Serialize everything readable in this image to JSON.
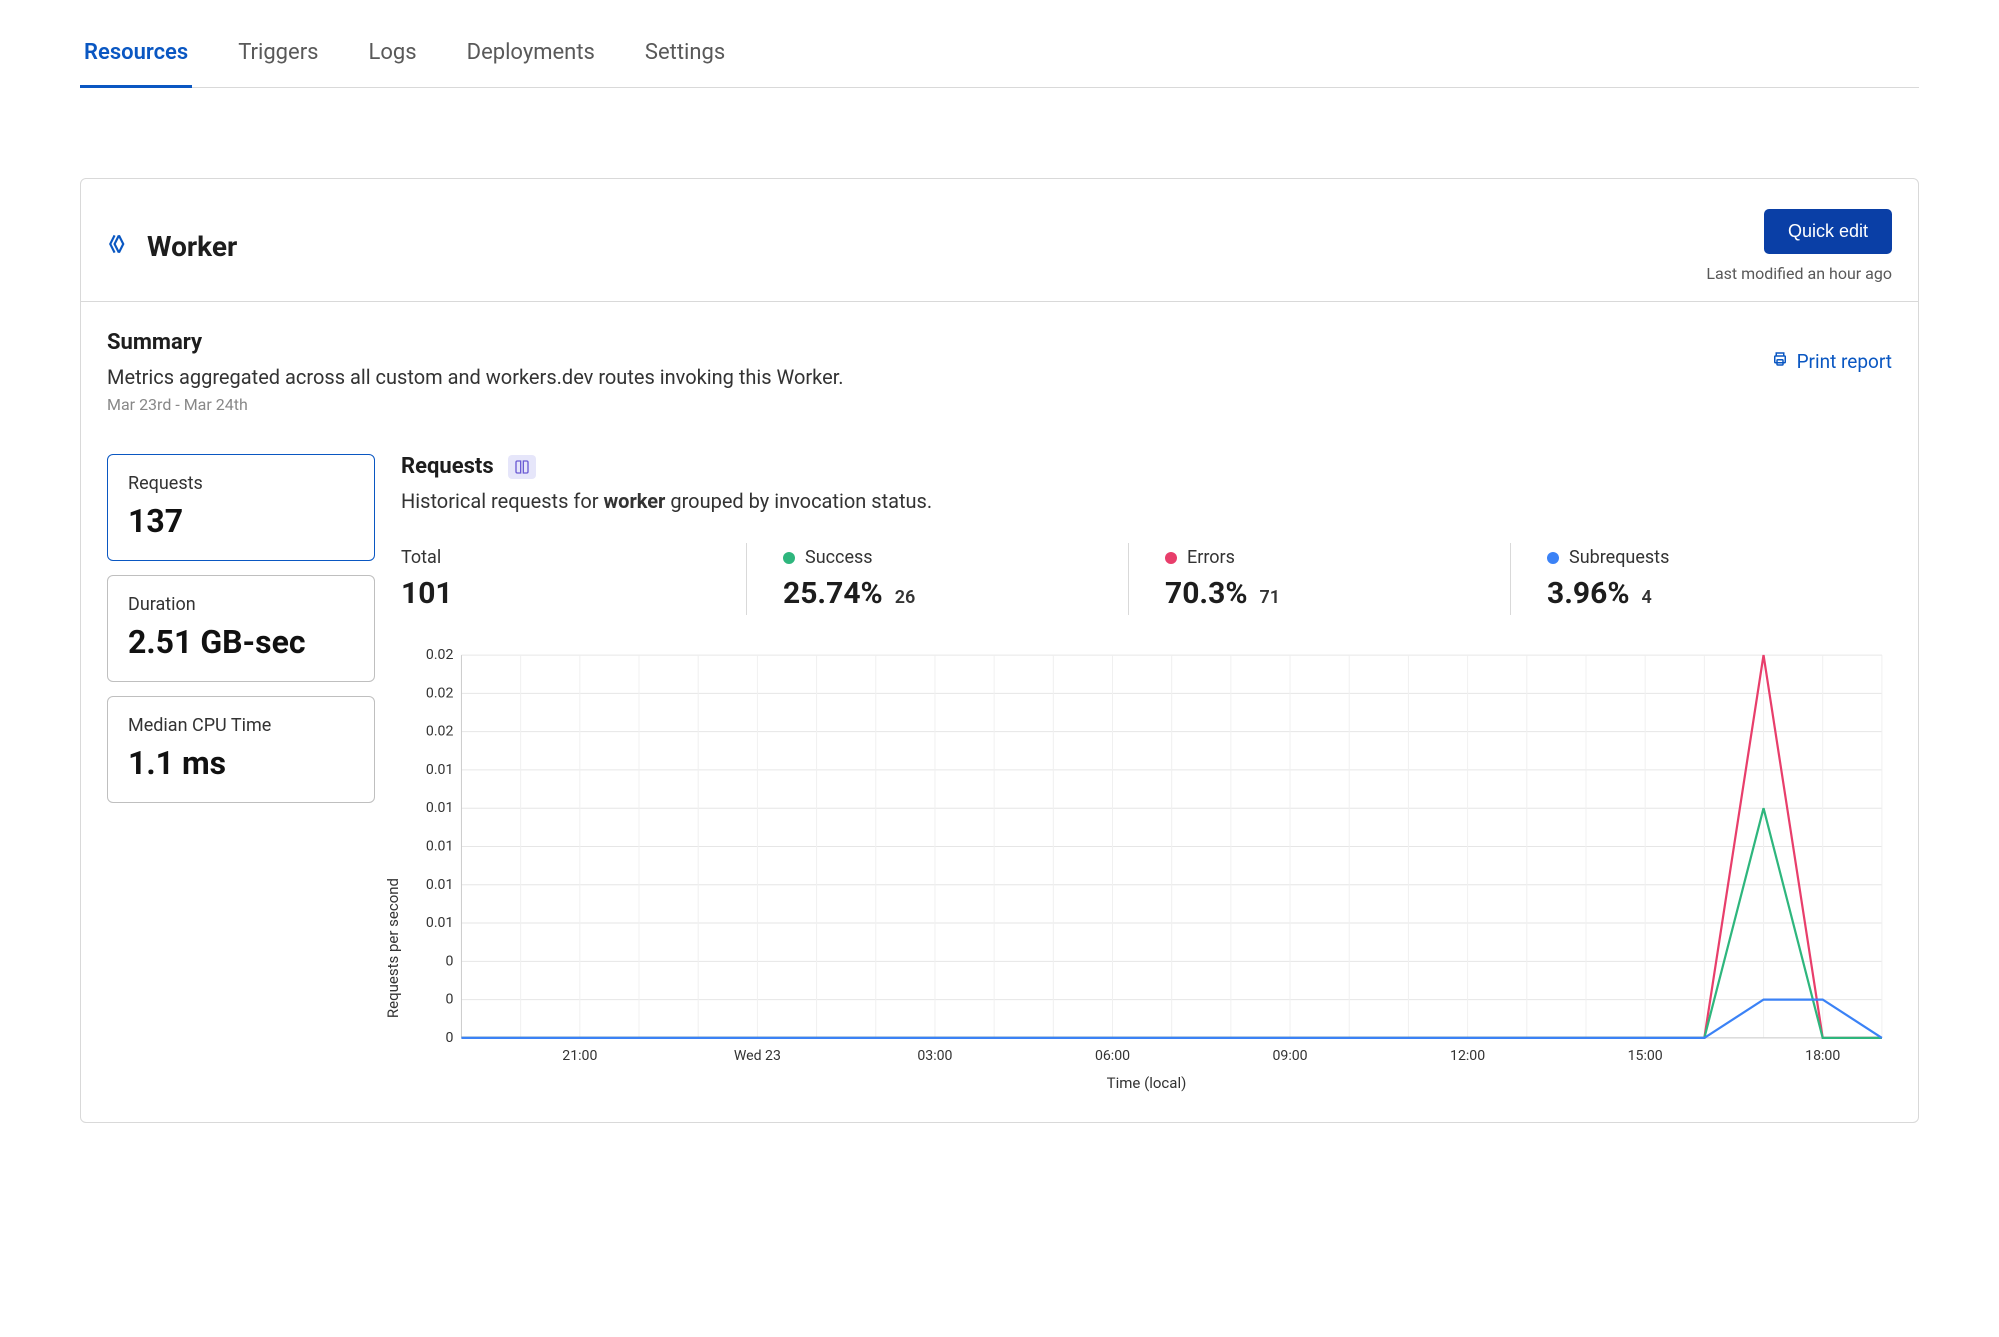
{
  "tabs": [
    {
      "label": "Resources",
      "active": true
    },
    {
      "label": "Triggers",
      "active": false
    },
    {
      "label": "Logs",
      "active": false
    },
    {
      "label": "Deployments",
      "active": false
    },
    {
      "label": "Settings",
      "active": false
    }
  ],
  "header": {
    "title": "Worker",
    "quick_edit_label": "Quick edit",
    "last_modified": "Last modified an hour ago"
  },
  "summary": {
    "heading": "Summary",
    "description": "Metrics aggregated across all custom and workers.dev routes invoking this Worker.",
    "date_range": "Mar 23rd - Mar 24th",
    "print_label": "Print report"
  },
  "metric_cards": [
    {
      "label": "Requests",
      "value": "137",
      "active": true
    },
    {
      "label": "Duration",
      "value": "2.51 GB-sec",
      "active": false
    },
    {
      "label": "Median CPU Time",
      "value": "1.1 ms",
      "active": false
    }
  ],
  "requests_section": {
    "heading": "Requests",
    "description_prefix": "Historical requests for ",
    "description_bold": "worker",
    "description_suffix": " grouped by invocation status."
  },
  "stats": {
    "total": {
      "label": "Total",
      "value": "101"
    },
    "success": {
      "label": "Success",
      "value": "25.74%",
      "count": "26"
    },
    "errors": {
      "label": "Errors",
      "value": "70.3%",
      "count": "71"
    },
    "subrequests": {
      "label": "Subrequests",
      "value": "3.96%",
      "count": "4"
    }
  },
  "chart_data": {
    "type": "line",
    "xlabel": "Time (local)",
    "ylabel": "Requests per second",
    "ylim": [
      0,
      0.02
    ],
    "y_ticks": [
      "0.02",
      "0.02",
      "0.02",
      "0.01",
      "0.01",
      "0.01",
      "0.01",
      "0.01",
      "0",
      "0",
      "0"
    ],
    "x_categories": [
      "21:00",
      "Wed 23",
      "03:00",
      "06:00",
      "09:00",
      "12:00",
      "15:00",
      "18:00"
    ],
    "series": [
      {
        "name": "Errors",
        "color": "#e83e6b",
        "values": [
          0,
          0,
          0,
          0,
          0,
          0,
          0,
          0,
          0,
          0,
          0,
          0,
          0,
          0,
          0,
          0,
          0,
          0,
          0,
          0,
          0,
          0,
          0.02,
          0,
          0
        ]
      },
      {
        "name": "Success",
        "color": "#2eb67d",
        "values": [
          0,
          0,
          0,
          0,
          0,
          0,
          0,
          0,
          0,
          0,
          0,
          0,
          0,
          0,
          0,
          0,
          0,
          0,
          0,
          0,
          0,
          0,
          0.012,
          0,
          0
        ]
      },
      {
        "name": "Subrequests",
        "color": "#3b82f6",
        "values": [
          0,
          0,
          0,
          0,
          0,
          0,
          0,
          0,
          0,
          0,
          0,
          0,
          0,
          0,
          0,
          0,
          0,
          0,
          0,
          0,
          0,
          0,
          0.002,
          0.002,
          0
        ]
      }
    ]
  },
  "colors": {
    "accent": "#0a57c2",
    "primary_button": "#0a3fa6",
    "success": "#2eb67d",
    "error": "#e83e6b",
    "subrequest": "#3b82f6"
  }
}
